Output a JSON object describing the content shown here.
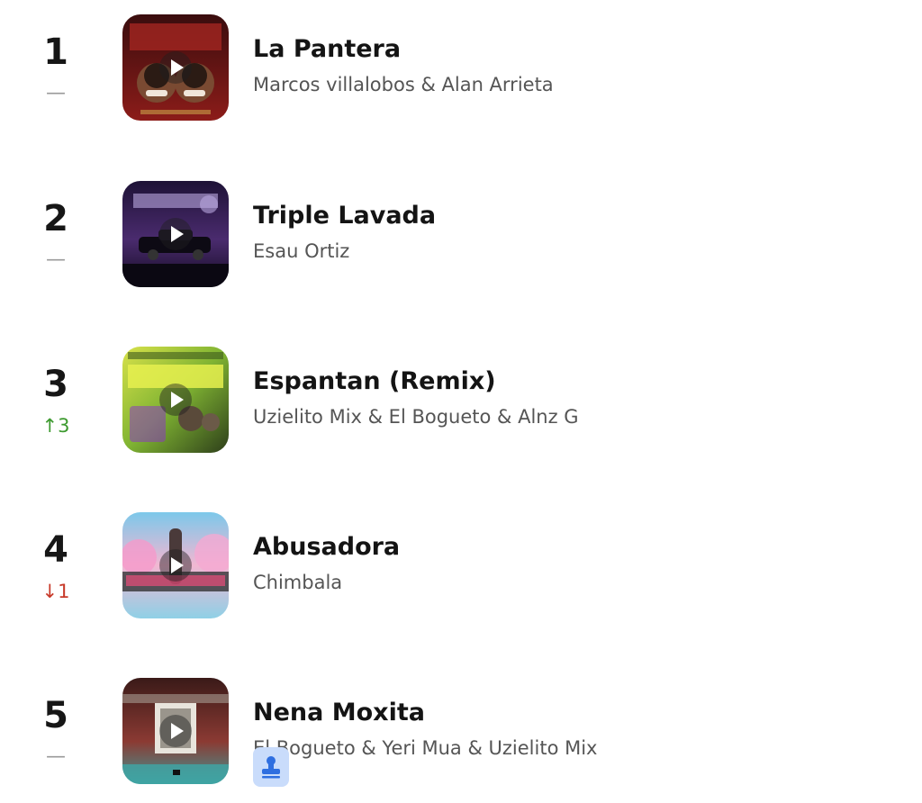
{
  "songs": [
    {
      "rank": "1",
      "change": "—",
      "trend": "same",
      "title": "La Pantera",
      "artist": "Marcos villalobos & Alan Arrieta",
      "cover_text": "LA PANTERA",
      "cover_colors": [
        "#6b1416",
        "#b5281f"
      ],
      "play_icon": "play-icon"
    },
    {
      "rank": "2",
      "change": "—",
      "trend": "same",
      "title": "Triple Lavada",
      "artist": "Esau Ortiz",
      "cover_text": "TRIPLE LAVADA",
      "cover_colors": [
        "#2b1a4a",
        "#6a3b8e"
      ],
      "play_icon": "play-icon"
    },
    {
      "rank": "3",
      "change": "↑3",
      "trend": "up",
      "title": "Espantan (Remix)",
      "artist": "Uzielito Mix & El Bogueto & Alnz G",
      "cover_text": "ESPANTAN",
      "cover_colors": [
        "#3b4a1c",
        "#a6d033"
      ],
      "play_icon": "play-icon"
    },
    {
      "rank": "4",
      "change": "↓1",
      "trend": "down",
      "title": "Abusadora",
      "artist": "Chimbala",
      "cover_text": "ABUSADORA",
      "cover_colors": [
        "#8fd3ea",
        "#f3a6c9"
      ],
      "play_icon": "play-icon"
    },
    {
      "rank": "5",
      "change": "—",
      "trend": "same",
      "title": "Nena Moxita",
      "artist": "El Bogueto & Yeri Mua & Uzielito Mix",
      "cover_colors": [
        "#7a2e2a",
        "#4fa7a6"
      ],
      "play_icon": "play-icon",
      "badge_icon": "stamp-icon",
      "badge_color": "#c9dcfb"
    }
  ]
}
